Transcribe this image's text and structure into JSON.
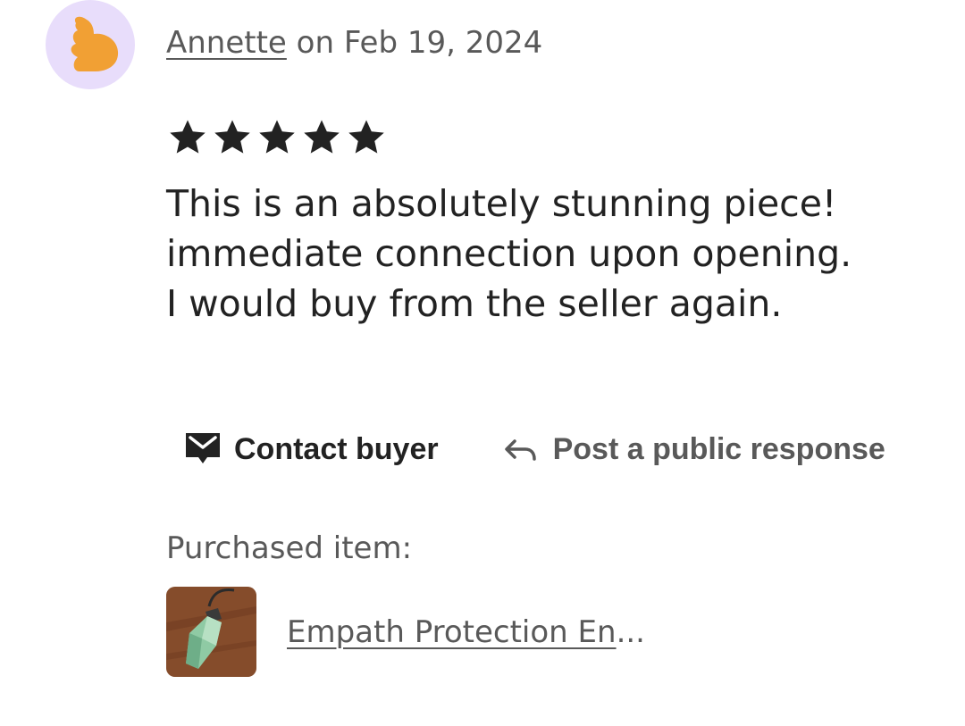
{
  "review": {
    "reviewer_name": "Annette",
    "date_text": " on Feb 19, 2024",
    "rating": 5,
    "rating_max": 5,
    "text_lines": [
      "This is an absolutely stunning piece!",
      "immediate connection upon opening.",
      "I would buy from the seller again."
    ]
  },
  "actions": {
    "contact_label": "Contact buyer",
    "public_response_label": "Post a public response"
  },
  "purchased": {
    "label": "Purchased item:",
    "item_title_visible": "Empath Protection En",
    "item_title_ellipsis": "..."
  },
  "icons": {
    "avatar": "hand-avatar-icon",
    "star": "star-icon",
    "contact": "envelope-icon",
    "reply": "reply-arrow-icon"
  },
  "colors": {
    "avatar_bg": "#e8ddfb",
    "avatar_figure": "#f1a034",
    "text_primary": "#222222",
    "text_secondary": "#595959"
  }
}
